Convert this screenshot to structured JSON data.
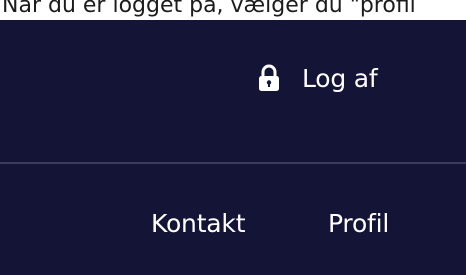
{
  "caption": {
    "text": "Når du er logget på, vælger du \"profil"
  },
  "header": {
    "logout": {
      "icon": "lock-icon",
      "label": "Log af"
    }
  },
  "nav": {
    "items": [
      {
        "label": "Kontakt"
      },
      {
        "label": "Profil"
      }
    ]
  },
  "colors": {
    "navbar_background": "#141437",
    "divider": "#3c3c5e",
    "nav_text": "#ffffff",
    "caption_text": "#1c1c1c",
    "page_background": "#ffffff"
  }
}
